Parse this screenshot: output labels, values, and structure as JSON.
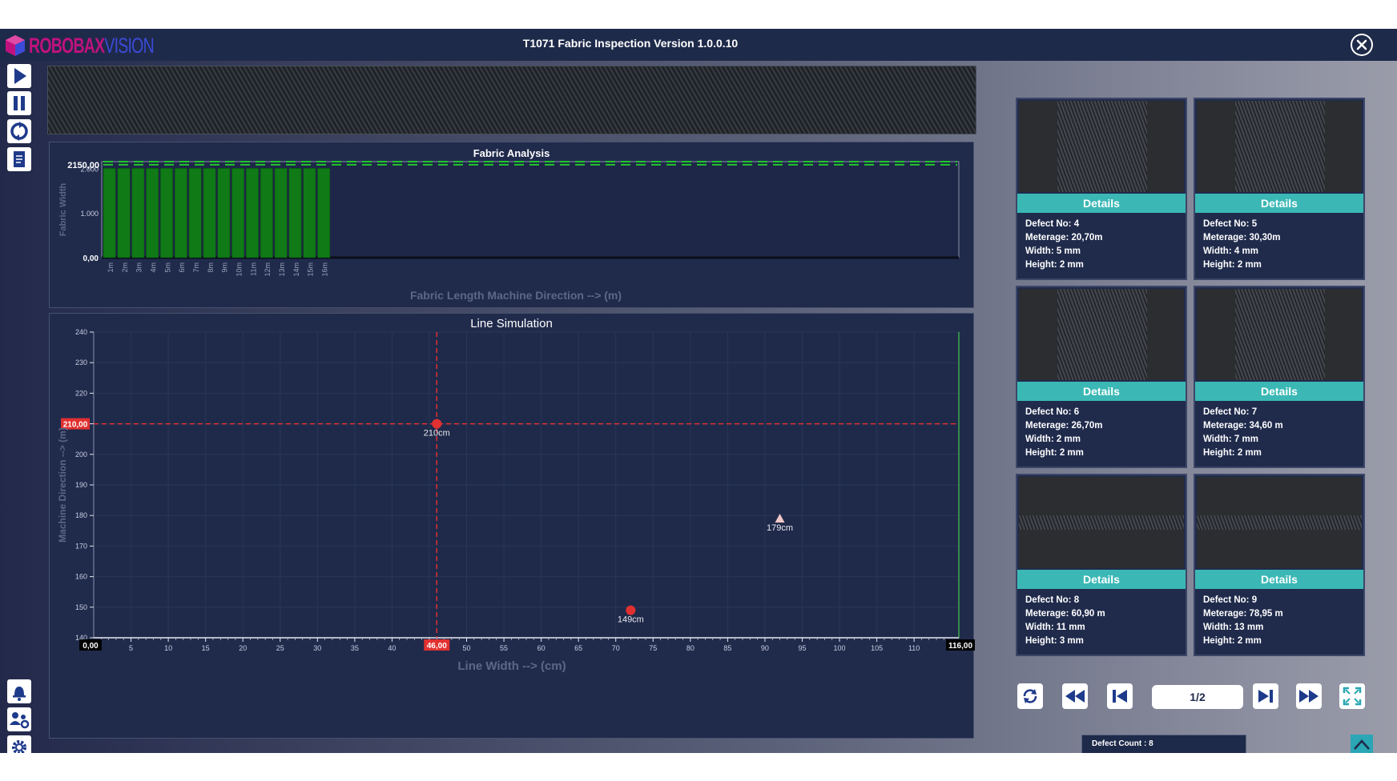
{
  "app": {
    "logo_text_main": "ROBOBAX",
    "logo_text_sub": "VISION",
    "title": "T1071 Fabric Inspection Version 1.0.0.10"
  },
  "icons": {
    "close": "close-icon",
    "play": "play-icon",
    "pause": "pause-icon",
    "reset": "reset-icon",
    "report": "report-icon",
    "alarm": "bell-icon",
    "users": "users-gear-icon",
    "settings": "gear-icon",
    "refresh": "refresh-icon",
    "rewind": "rewind-icon",
    "first": "skip-first-icon",
    "last": "skip-last-icon",
    "forward": "fast-forward-icon",
    "fullscreen": "fullscreen-icon",
    "scroll_up": "chevron-up-icon"
  },
  "colors": {
    "panel_bg": "#202b4c",
    "bar": "#0f7a16",
    "limit_line": "#22c52e",
    "cursor": "#e23030",
    "accent": "#3bb8b5"
  },
  "fabric_analysis": {
    "title": "Fabric Analysis",
    "current_value_label": "2150,00",
    "zero_label": "0,00"
  },
  "line_simulation": {
    "title": "Line Simulation",
    "y_cursor_label": "210,00",
    "x_cursor_label": "46,00",
    "x_min_label": "0,00",
    "x_max_label": "116,00"
  },
  "chart_data": [
    {
      "type": "bar",
      "title": "Fabric Analysis",
      "xlabel": "Fabric Length Machine Direction --> (m)",
      "ylabel": "Fabric Width",
      "categories": [
        "1m",
        "2m",
        "3m",
        "4m",
        "5m",
        "6m",
        "7m",
        "8m",
        "9m",
        "10m",
        "11m",
        "12m",
        "13m",
        "14m",
        "15m",
        "16m"
      ],
      "values": [
        2000,
        2000,
        2000,
        2000,
        2000,
        2000,
        2000,
        2000,
        2000,
        2000,
        2000,
        2000,
        2000,
        2000,
        2000,
        2000
      ],
      "y_ticks": [
        "0,00",
        "1.000",
        "2.000"
      ],
      "ylim": [
        0,
        2150
      ],
      "reference_line": 2150,
      "x_extent": 60,
      "grid": false
    },
    {
      "type": "scatter",
      "title": "Line Simulation",
      "xlabel": "Line Width --> (cm)",
      "ylabel": "Machine Direction --> (m)",
      "xlim": [
        0,
        116
      ],
      "ylim": [
        140,
        240
      ],
      "x_ticks": [
        5,
        10,
        15,
        20,
        25,
        30,
        35,
        40,
        45,
        50,
        55,
        60,
        65,
        70,
        75,
        80,
        85,
        90,
        95,
        100,
        105,
        110
      ],
      "y_ticks": [
        140,
        150,
        160,
        170,
        180,
        190,
        200,
        210,
        220,
        230,
        240
      ],
      "cursor_x": 46,
      "cursor_y": 210,
      "points": [
        {
          "x": 46,
          "y": 210,
          "label": "210cm",
          "marker": "circle",
          "color": "#e23030"
        },
        {
          "x": 72,
          "y": 149,
          "label": "149cm",
          "marker": "circle",
          "color": "#e23030"
        },
        {
          "x": 92,
          "y": 179,
          "label": "179cm",
          "marker": "triangle",
          "color": "#f0c8c8"
        }
      ],
      "grid": true
    }
  ],
  "defects": {
    "labels": {
      "details": "Details",
      "defect_no": "Defect No:",
      "meterage": "Meterage:",
      "width": "Width:",
      "height": "Height:"
    },
    "items": [
      {
        "no": "4",
        "meterage": "20,70m",
        "width": "5 mm",
        "height": "2 mm"
      },
      {
        "no": "5",
        "meterage": "30,30m",
        "width": "4 mm",
        "height": "2 mm"
      },
      {
        "no": "6",
        "meterage": "26,70m",
        "width": "2 mm",
        "height": "2 mm"
      },
      {
        "no": "7",
        "meterage": "34,60 m",
        "width": "7 mm",
        "height": "2 mm"
      },
      {
        "no": "8",
        "meterage": "60,90 m",
        "width": "11 mm",
        "height": "3 mm"
      },
      {
        "no": "9",
        "meterage": "78,95 m",
        "width": "13 mm",
        "height": "2 mm"
      }
    ]
  },
  "pager": {
    "page": "1/2"
  },
  "status": {
    "defect_count_label": "Defect Count :",
    "defect_count": "8"
  }
}
